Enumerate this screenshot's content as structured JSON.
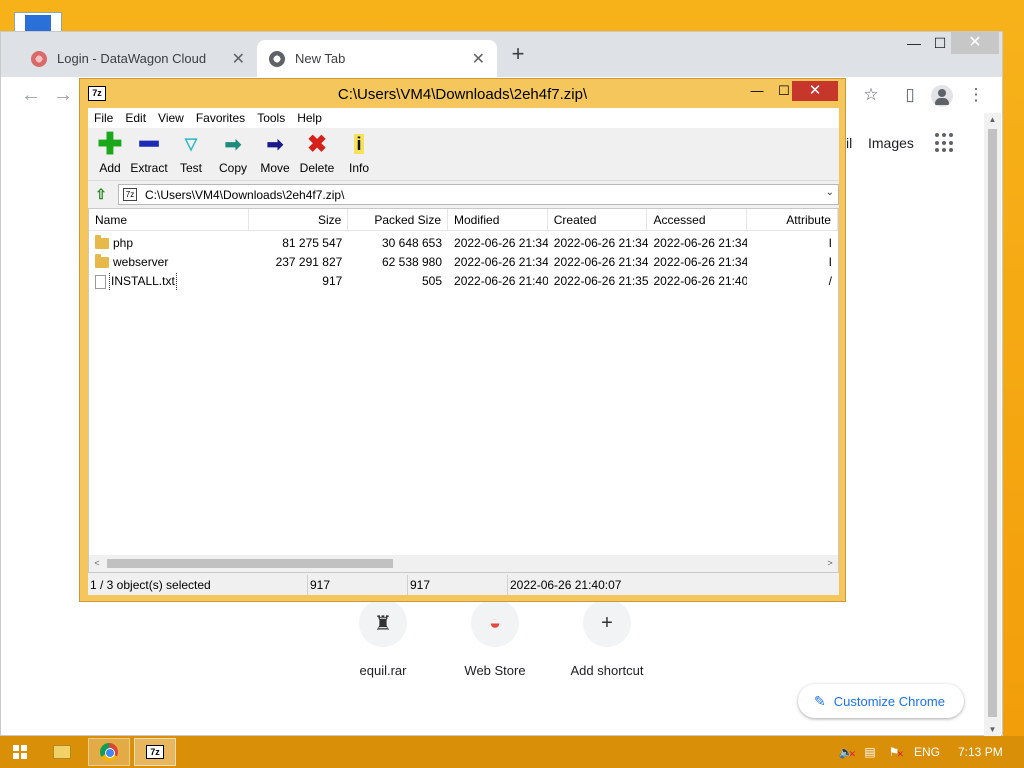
{
  "chrome": {
    "tabs": [
      {
        "title": "Login - DataWagon Cloud",
        "close": "✕"
      },
      {
        "title": "New Tab",
        "close": "✕"
      }
    ],
    "new_tab": "+",
    "window_buttons": {
      "minimize": "—",
      "maximize": "☐",
      "close": "✕"
    },
    "nav": {
      "back": "←",
      "forward": "→"
    },
    "toolbar_icons": {
      "star": "☆",
      "sidepanel": "▯",
      "menu": "⋮"
    },
    "page": {
      "links": {
        "gmail": "il",
        "images": "Images"
      },
      "shortcuts": [
        {
          "label": "equil.rar",
          "icon": "♜"
        },
        {
          "label": "Web Store",
          "icon": "◒"
        },
        {
          "label": "Add shortcut",
          "icon": "+"
        }
      ],
      "customize_label": "Customize Chrome",
      "customize_icon": "✎"
    },
    "scrollbar": {
      "up": "▲",
      "down": "▼"
    }
  },
  "sevenzip": {
    "logo": "7z",
    "title": "C:\\Users\\VM4\\Downloads\\2eh4f7.zip\\",
    "window_buttons": {
      "minimize": "—",
      "maximize": "☐",
      "close": "✕"
    },
    "menu": [
      "File",
      "Edit",
      "View",
      "Favorites",
      "Tools",
      "Help"
    ],
    "toolbar": [
      {
        "label": "Add",
        "icon": "✚"
      },
      {
        "label": "Extract",
        "icon": "━"
      },
      {
        "label": "Test",
        "icon": "▽"
      },
      {
        "label": "Copy",
        "icon": "➡"
      },
      {
        "label": "Move",
        "icon": "➡"
      },
      {
        "label": "Delete",
        "icon": "✖"
      },
      {
        "label": "Info",
        "icon": "i"
      }
    ],
    "address": {
      "up": "⇧",
      "path": "C:\\Users\\VM4\\Downloads\\2eh4f7.zip\\",
      "dropdown": "⌄"
    },
    "columns": [
      "Name",
      "Size",
      "Packed Size",
      "Modified",
      "Created",
      "Accessed",
      "Attribute"
    ],
    "rows": [
      {
        "type": "folder",
        "name": "php",
        "size": "81 275 547",
        "packed": "30 648 653",
        "modified": "2022-06-26 21:34",
        "created": "2022-06-26 21:34",
        "accessed": "2022-06-26 21:34",
        "attr": "I"
      },
      {
        "type": "folder",
        "name": "webserver",
        "size": "237 291 827",
        "packed": "62 538 980",
        "modified": "2022-06-26 21:34",
        "created": "2022-06-26 21:34",
        "accessed": "2022-06-26 21:34",
        "attr": "I"
      },
      {
        "type": "file",
        "name": "INSTALL.txt",
        "size": "917",
        "packed": "505",
        "modified": "2022-06-26 21:40",
        "created": "2022-06-26 21:35",
        "accessed": "2022-06-26 21:40",
        "attr": "/"
      }
    ],
    "hscroll": {
      "left": "<",
      "right": ">"
    },
    "status": {
      "selection": "1 / 3 object(s) selected",
      "size": "917",
      "packed": "917",
      "modified": "2022-06-26 21:40:07"
    }
  },
  "taskbar": {
    "sevenzip_label": "7z",
    "language": "ENG",
    "clock": "7:13 PM",
    "tray_icons": [
      "speaker-muted-icon",
      "network-icon",
      "action-center-icon"
    ]
  }
}
